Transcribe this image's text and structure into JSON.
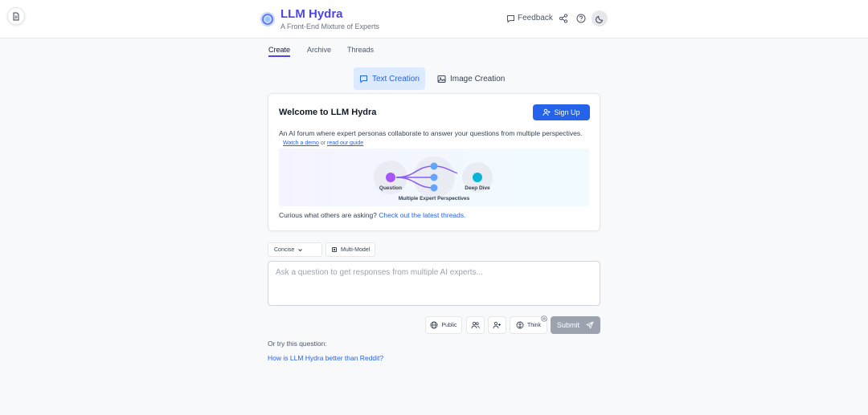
{
  "header": {
    "title": "LLM Hydra",
    "subtitle": "A Front-End Mixture of Experts",
    "feedback_label": "Feedback",
    "icons": [
      "document-icon",
      "hydra-logo-icon",
      "message-icon",
      "share-icon",
      "help-icon",
      "moon-icon"
    ]
  },
  "nav": {
    "tabs": [
      {
        "label": "Create",
        "active": true
      },
      {
        "label": "Archive"
      },
      {
        "label": "Threads"
      }
    ]
  },
  "modes": {
    "text": "Text Creation",
    "image": "Image Creation",
    "active": "text"
  },
  "welcome": {
    "title": "Welcome to LLM Hydra",
    "signup_label": "Sign Up",
    "description": "An AI forum where expert personas collaborate to answer your questions from multiple perspectives.",
    "demo_link": "Watch a demo",
    "or_text": "or",
    "guide_link": "read our guide",
    "diagram": {
      "question_label": "Question",
      "experts_label": "Multiple Expert Perspectives",
      "deepdive_label": "Deep Dive"
    },
    "curious_text": "Curious what others are asking?",
    "curious_link": "Check out the latest threads."
  },
  "options": {
    "style_select": "Concise",
    "multimodel_label": "Multi-Model"
  },
  "input": {
    "placeholder": "Ask a question to get responses from multiple AI experts..."
  },
  "toolbar": {
    "public_label": "Public",
    "think_label": "Think",
    "submit_label": "Submit"
  },
  "suggestion": {
    "label": "Or try this question:",
    "question": "How is LLM Hydra better than Reddit?"
  },
  "colors": {
    "accent": "#4f46e5",
    "primary_button": "#2563eb",
    "question_node": "#a855f7",
    "expert_node": "#60a5fa",
    "deepdive_node": "#06b6d4",
    "submit_disabled": "#9ca3af"
  }
}
